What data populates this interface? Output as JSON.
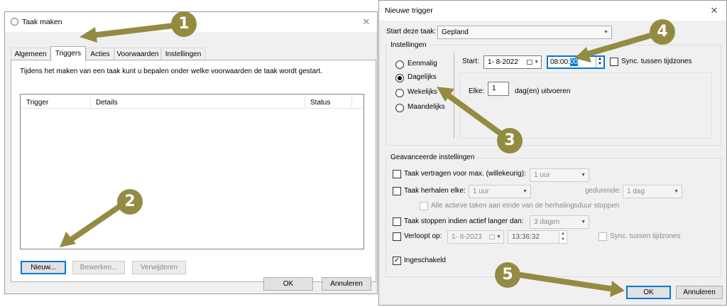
{
  "left_window": {
    "title": "Taak maken",
    "tabs": [
      {
        "label": "Algemeen",
        "active": false
      },
      {
        "label": "Triggers",
        "active": true
      },
      {
        "label": "Acties",
        "active": false
      },
      {
        "label": "Voorwaarden",
        "active": false
      },
      {
        "label": "Instellingen",
        "active": false
      }
    ],
    "description": "Tijdens het maken van een taak kunt u bepalen onder welke voorwaarden de taak wordt gestart.",
    "table_headers": [
      "Trigger",
      "Details",
      "Status"
    ],
    "buttons": {
      "new": "Nieuw...",
      "edit": "Bewerken...",
      "delete": "Verwijderen",
      "ok": "OK",
      "cancel": "Annuleren"
    }
  },
  "right_window": {
    "title": "Nieuwe trigger",
    "start_task_label": "Start deze taak:",
    "start_task_value": "Gepland",
    "settings_group": "Instellingen",
    "schedule_options": [
      {
        "label": "Eenmalig",
        "selected": false
      },
      {
        "label": "Dagelijks",
        "selected": true
      },
      {
        "label": "Wekelijks",
        "selected": false
      },
      {
        "label": "Maandelijks",
        "selected": false
      }
    ],
    "start_label": "Start:",
    "start_date": "1- 8-2022",
    "start_time_prefix": "08:00:",
    "start_time_selected": "00",
    "sync_timezones": "Sync. tussen tijdzones",
    "every_label": "Elke:",
    "every_value": "1",
    "every_suffix": "dag(en) uitvoeren",
    "advanced_group": "Geavanceerde instellingen",
    "delay_label": "Taak vertragen voor max. (willekeurig):",
    "delay_value": "1 uur",
    "repeat_label": "Taak herhalen elke:",
    "repeat_value": "1 uur",
    "duration_label": "gedurende:",
    "duration_value": "1 dag",
    "stop_all_label": "Alle actieve taken aan einde van de herhalingsduur stoppen",
    "stop_if_label": "Taak stoppen indien actief langer dan:",
    "stop_if_value": "3 dagen",
    "expires_label": "Verloopt op:",
    "expires_date": "1- 8-2023",
    "expires_time": "13:36:32",
    "expires_sync": "Sync. tussen tijdzones",
    "enabled_label": "Ingeschakeld",
    "enabled_mark": "✓",
    "ok": "OK",
    "cancel": "Annuleren"
  },
  "callouts": [
    "1",
    "2",
    "3",
    "4",
    "5"
  ],
  "colors": {
    "callout": "#948b42",
    "focus": "#0078d7",
    "selection": "#0078d7"
  }
}
